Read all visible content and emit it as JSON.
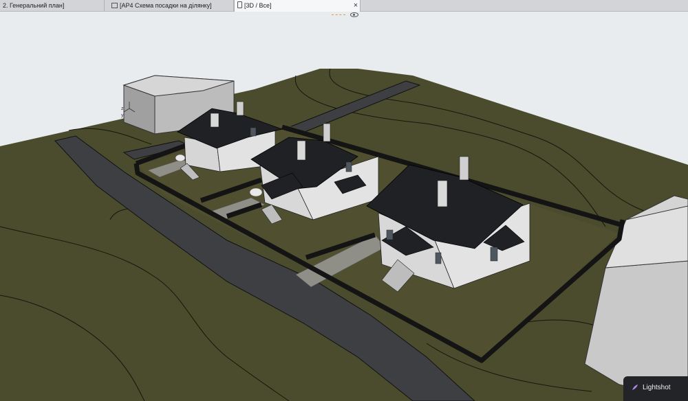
{
  "tabs": [
    {
      "label": "2. Генеральний план]",
      "active": false
    },
    {
      "label": "[АР4 Схема посадки на ділянку]",
      "active": false
    },
    {
      "label": "[3D / Все]",
      "active": true
    }
  ],
  "close_symbol": "×",
  "axes": {
    "z": "z",
    "y": "y"
  },
  "notification": {
    "label": "Lightshot"
  },
  "colors": {
    "terrain": "#4a4a2c",
    "road": "#3e4043",
    "roof": "#1f2124",
    "wall": "#d9d9da",
    "fence": "#151515",
    "sky": "#e9ecef"
  }
}
